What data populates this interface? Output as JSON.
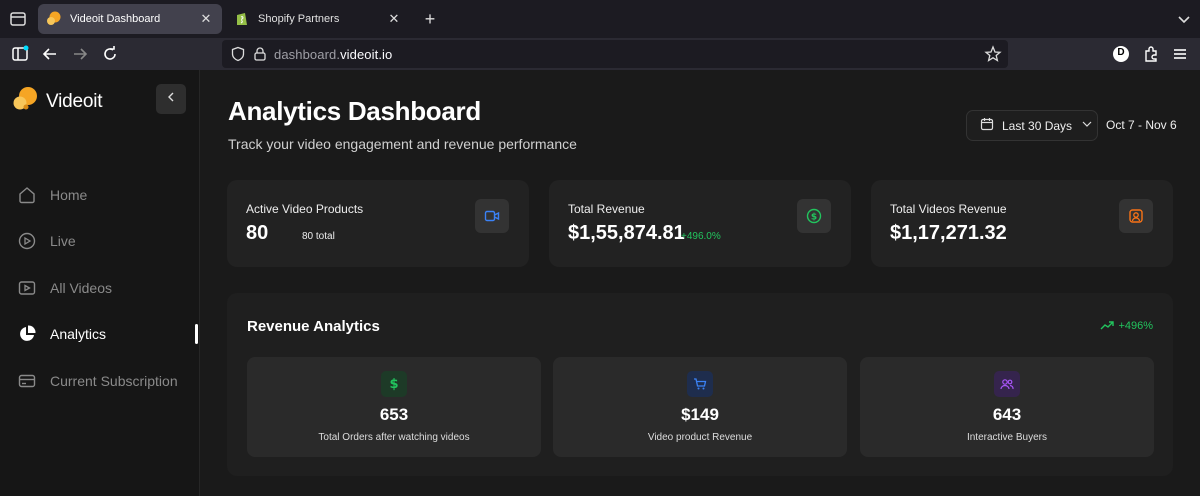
{
  "browser": {
    "tabs": [
      {
        "title": "Videoit Dashboard",
        "active": true
      },
      {
        "title": "Shopify Partners",
        "active": false
      }
    ],
    "url_prefix": "dashboard.",
    "url_domain": "videoit.io",
    "profile_initial": "D"
  },
  "sidebar": {
    "logo_text": "Videoit",
    "items": [
      {
        "label": "Home",
        "icon": "home-icon"
      },
      {
        "label": "Live",
        "icon": "live-icon"
      },
      {
        "label": "All Videos",
        "icon": "video-icon"
      },
      {
        "label": "Analytics",
        "icon": "pie-chart-icon",
        "active": true
      },
      {
        "label": "Current Subscription",
        "icon": "credit-card-icon"
      }
    ]
  },
  "header": {
    "title": "Analytics Dashboard",
    "subtitle": "Track your video engagement and revenue performance",
    "range_label": "Last 30 Days",
    "date_range": "Oct 7 - Nov 6"
  },
  "cards": [
    {
      "label": "Active Video Products",
      "value": "80",
      "sub": "80 total",
      "icon": "video-camera-icon",
      "accent": "#3b82f6"
    },
    {
      "label": "Total Revenue",
      "value": "$1,55,874.81",
      "sub": "+496.0%",
      "icon": "dollar-circle-icon",
      "accent": "#22c55e"
    },
    {
      "label": "Total Videos Revenue",
      "value": "$1,17,271.32",
      "icon": "user-square-icon",
      "accent": "#f97316"
    }
  ],
  "revenue": {
    "title": "Revenue Analytics",
    "growth": "+496%",
    "stats": [
      {
        "value": "653",
        "label": "Total Orders after watching videos",
        "icon": "dollar-icon",
        "accent": "#22c55e"
      },
      {
        "value": "$149",
        "label": "Video product Revenue",
        "icon": "cart-icon",
        "accent": "#3b82f6"
      },
      {
        "value": "643",
        "label": "Interactive Buyers",
        "icon": "users-icon",
        "accent": "#a855f7"
      }
    ]
  }
}
